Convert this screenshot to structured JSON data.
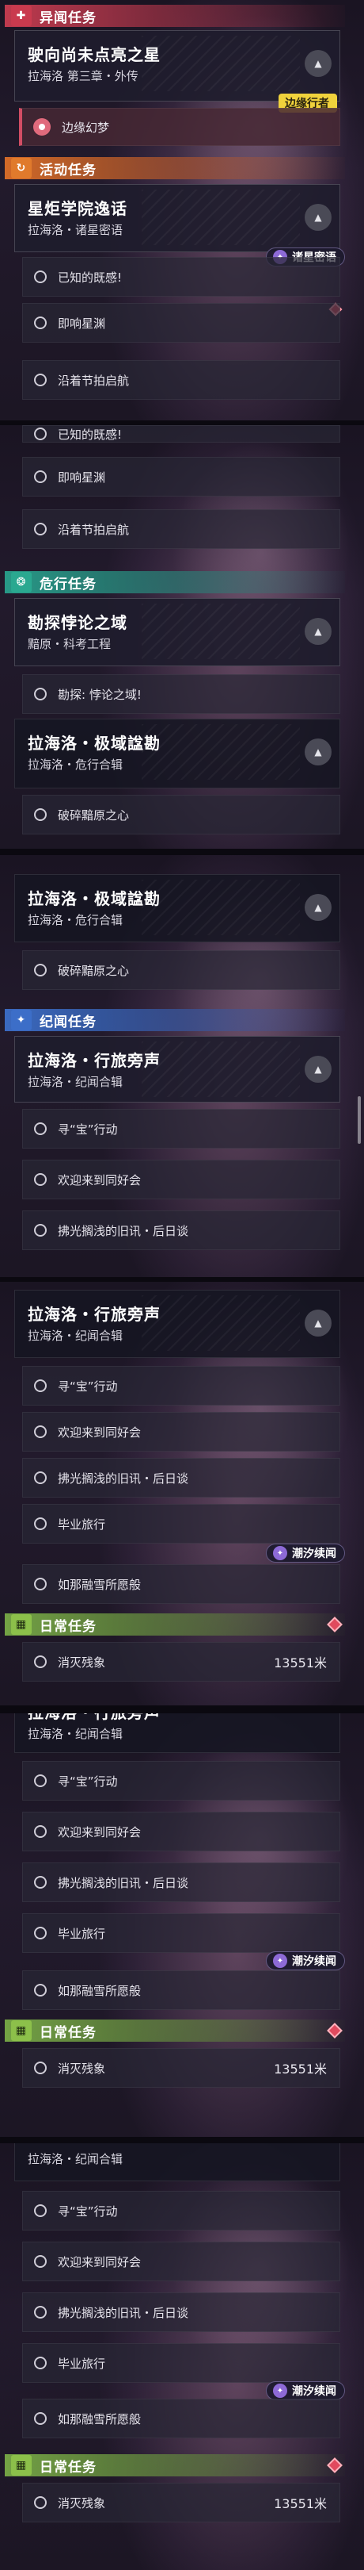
{
  "frame1": {
    "cat_yiwen": {
      "label": "异闻任务",
      "icon": "✚"
    },
    "quest1": {
      "title": "驶向尚未点亮之星",
      "sub": "拉海洛 第三章・外传",
      "tag": "边缘行者"
    },
    "quest1_obj": "边缘幻梦",
    "cat_huodong": {
      "label": "活动任务",
      "icon": "↻"
    },
    "quest2": {
      "title": "星炬学院逸话",
      "sub": "拉海洛・诸星密语",
      "tag": "诸星密语"
    },
    "quest2_objs": [
      "已知的既感!",
      "即响星渊",
      "沿着节拍启航"
    ]
  },
  "frame2": {
    "objs_top": [
      "已知的既感!",
      "即响星渊",
      "沿着节拍启航"
    ],
    "cat_weixing": {
      "label": "危行任务",
      "icon": "❂"
    },
    "quest3": {
      "title": "勘探悖论之域",
      "sub": "黯原・科考工程"
    },
    "quest3_obj": "勘探: 悖论之域!",
    "quest4": {
      "title": "拉海洛・极域諡勘",
      "sub": "拉海洛・危行合辑"
    },
    "quest4_obj": "破碎黯原之心"
  },
  "frame3": {
    "quest4": {
      "title": "拉海洛・极域諡勘",
      "sub": "拉海洛・危行合辑"
    },
    "quest4_obj": "破碎黯原之心",
    "cat_jiwen": {
      "label": "纪闻任务",
      "icon": "✦"
    },
    "quest5": {
      "title": "拉海洛・行旅旁声",
      "sub": "拉海洛・纪闻合辑"
    },
    "quest5_objs": [
      "寻“宝”行动",
      "欢迎来到同好会",
      "拂光搁浅的旧讯・后日谈"
    ]
  },
  "frame4": {
    "quest5": {
      "title": "拉海洛・行旅旁声",
      "sub": "拉海洛・纪闻合辑"
    },
    "objs": [
      "寻“宝”行动",
      "欢迎来到同好会",
      "拂光搁浅的旧讯・后日谈",
      "毕业旅行",
      "如那融雪所愿般"
    ],
    "tag": "潮汐续闻",
    "cat_richang": {
      "label": "日常任务",
      "icon": "▦"
    },
    "daily_obj": "消灭残象",
    "daily_dist": "13551米"
  },
  "frame5": {
    "partial_title": "拉海洛・行旅旁声",
    "sub": "拉海洛・纪闻合辑",
    "objs": [
      "寻“宝”行动",
      "欢迎来到同好会",
      "拂光搁浅的旧讯・后日谈",
      "毕业旅行",
      "如那融雪所愿般"
    ],
    "tag": "潮汐续闻",
    "cat_richang": {
      "label": "日常任务",
      "icon": "▦"
    },
    "daily_obj": "消灭残象",
    "daily_dist": "13551米"
  },
  "frame6": {
    "sub": "拉海洛・纪闻合辑",
    "objs": [
      "寻“宝”行动",
      "欢迎来到同好会",
      "拂光搁浅的旧讯・后日谈",
      "毕业旅行",
      "如那融雪所愿般"
    ],
    "tag": "潮汐续闻",
    "cat_richang": {
      "label": "日常任务",
      "icon": "▦"
    },
    "daily_obj": "消灭残象",
    "daily_dist": "13551米"
  },
  "collapse_glyph": "▲",
  "colors": {
    "accent_red": "#d24d64",
    "tag_yellow": "#f0d23c",
    "daily_green": "#8cc04a"
  }
}
